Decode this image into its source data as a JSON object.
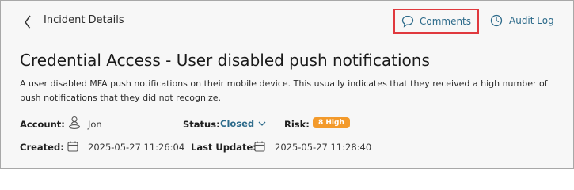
{
  "header": {
    "title": "Incident Details",
    "comments_label": "Comments",
    "audit_log_label": "Audit Log"
  },
  "incident": {
    "title": "Credential Access - User disabled push notifications",
    "description": "A user disabled MFA push notifications on their mobile device. This usually indicates that they received a high number of push notifications that they did not recognize."
  },
  "fields": {
    "account_label": "Account:",
    "account_value": "Jon",
    "status_label": "Status:",
    "status_value": "Closed",
    "risk_label": "Risk:",
    "risk_value": "8 High",
    "created_label": "Created:",
    "created_value": "2025-05-27 11:26:04",
    "last_update_label": "Last Update:",
    "last_update_value": "2025-05-27 11:28:40"
  },
  "icons": {
    "back": "chevron-left-icon",
    "comments": "speech-bubble-icon",
    "audit_log": "clock-icon",
    "account": "user-icon",
    "status": "chevron-down-icon",
    "date": "calendar-icon"
  },
  "colors": {
    "accent": "#2c6a8a",
    "highlight_border": "#e0393e",
    "risk_high": "#f39a2b"
  }
}
